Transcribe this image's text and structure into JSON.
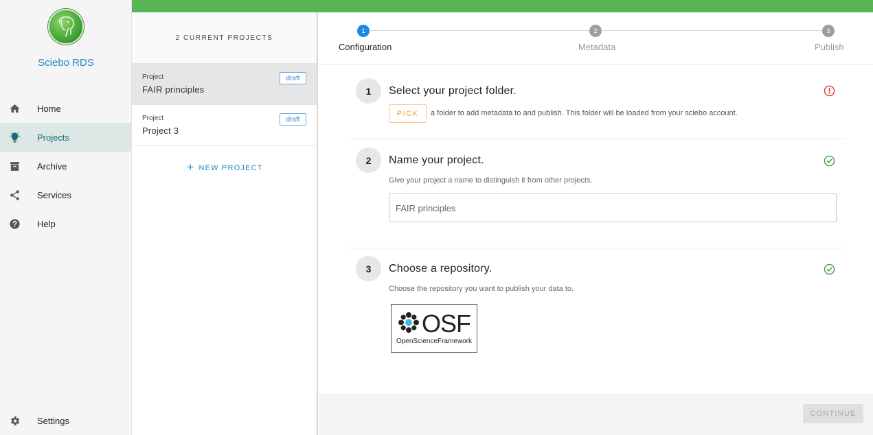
{
  "app": {
    "name": "Sciebo RDS",
    "brand_color": "#1e88c8",
    "topbar_color": "#57b557"
  },
  "nav": {
    "items": [
      {
        "label": "Home",
        "icon": "home-icon"
      },
      {
        "label": "Projects",
        "icon": "lightbulb-icon",
        "active": true
      },
      {
        "label": "Archive",
        "icon": "archive-icon"
      },
      {
        "label": "Services",
        "icon": "share-icon"
      },
      {
        "label": "Help",
        "icon": "help-icon"
      }
    ],
    "settings": {
      "label": "Settings",
      "icon": "gear-icon"
    }
  },
  "projects": {
    "header": "2 CURRENT PROJECTS",
    "items": [
      {
        "caption": "Project",
        "name": "FAIR principles",
        "badge": "draft",
        "selected": true
      },
      {
        "caption": "Project",
        "name": "Project 3",
        "badge": "draft",
        "selected": false
      }
    ],
    "new_label": "NEW PROJECT"
  },
  "stepper": {
    "steps": [
      {
        "number": "1",
        "label": "Configuration",
        "active": true
      },
      {
        "number": "2",
        "label": "Metadata",
        "active": false
      },
      {
        "number": "3",
        "label": "Publish",
        "active": false
      }
    ]
  },
  "config": {
    "steps": [
      {
        "number": "1",
        "title": "Select your project folder.",
        "pick_label": "PICK",
        "description": "a folder to add metadata to and publish. This folder will be loaded from your sciebo account.",
        "status": "error-icon",
        "status_color": "#e53935"
      },
      {
        "number": "2",
        "title": "Name your project.",
        "description": "Give your project a name to distinguish it from other projects.",
        "input_value": "FAIR principles",
        "status": "check-circle-icon",
        "status_color": "#43a047"
      },
      {
        "number": "3",
        "title": "Choose a repository.",
        "description": "Choose the repository you want to publish your data to.",
        "repository": {
          "logo_text": "OSF",
          "name": "OpenScienceFramework"
        },
        "status": "check-circle-icon",
        "status_color": "#43a047"
      }
    ]
  },
  "footer": {
    "continue_label": "CONTINUE"
  }
}
